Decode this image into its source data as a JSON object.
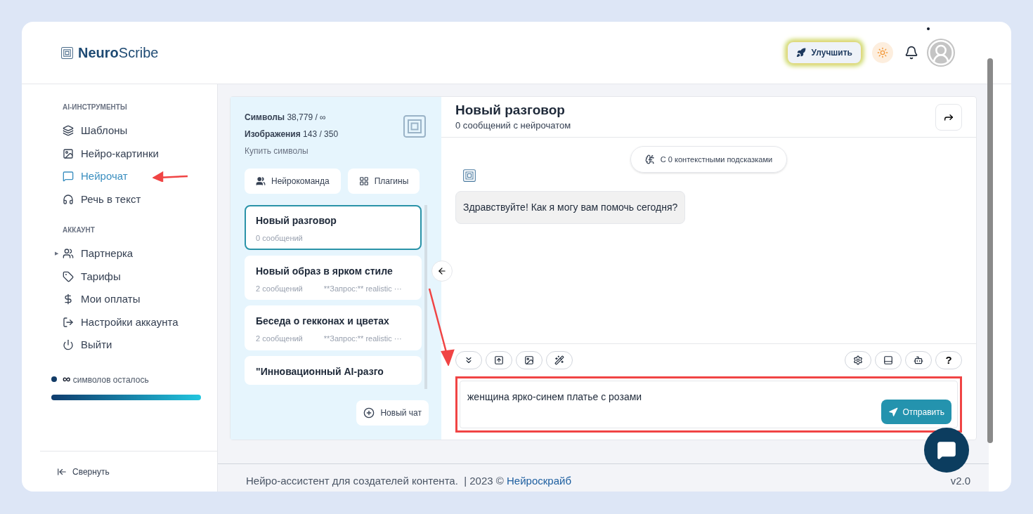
{
  "header": {
    "logo_bold": "Neuro",
    "logo_light": "Scribe",
    "upgrade_button": "Улучшить",
    "notification_dot": true
  },
  "sidebar": {
    "sections": [
      {
        "title": "AI-ИНСТРУМЕНТЫ",
        "items": [
          {
            "label": "Шаблоны",
            "selected": false
          },
          {
            "label": "Нейро-картинки",
            "selected": false
          },
          {
            "label": "Нейрочат",
            "selected": true
          },
          {
            "label": "Речь в текст",
            "selected": false
          }
        ]
      },
      {
        "title": "АККАУНТ",
        "items": [
          {
            "label": "Партнерка",
            "caret": "▶",
            "selected": false
          },
          {
            "label": "Тарифы",
            "selected": false
          },
          {
            "label": "Мои оплаты",
            "selected": false
          },
          {
            "label": "Настройки аккаунта",
            "selected": false
          },
          {
            "label": "Выйти",
            "selected": false
          }
        ]
      }
    ],
    "credits": {
      "amount": "∞",
      "label": "символов осталось"
    },
    "collapse": "Свернуть"
  },
  "chat_panel": {
    "symbols_label": "Символы",
    "symbols_value": "38,779 / ∞",
    "images_label": "Изображения",
    "images_value": "143 / 350",
    "buy_link": "Купить символы",
    "team_button": "Нейрокоманда",
    "plugins_button": "Плагины",
    "chats": [
      {
        "title": "Новый разговор",
        "count": "0 сообщений",
        "selected": true
      },
      {
        "title": "Новый образ в ярком стиле",
        "count": "2 сообщений",
        "preview": "**Запрос:** realistic ···",
        "selected": false
      },
      {
        "title": "Беседа о гекконах и цветах",
        "count": "2 сообщений",
        "preview": "**Запрос:** realistic ···",
        "selected": false
      },
      {
        "title": "\"Инновационный AI-разго",
        "selected": false
      }
    ],
    "new_chat": "Новый чат"
  },
  "conversation": {
    "title": "Новый разговор",
    "subtitle": "0 сообщений с нейрочатом",
    "context_pill": "С 0 контекстными подсказками",
    "messages": [
      {
        "text": "Здравствуйте! Как я могу вам помочь сегодня?"
      }
    ],
    "input": {
      "value": "женщина ярко-синем платье с розами"
    },
    "send_button": "Отправить",
    "help_button": "?"
  },
  "footer": {
    "text": "Нейро-ассистент для создателей контента.  | 2023 © ",
    "link": "Нейроскрайб",
    "version": "v2.0"
  }
}
